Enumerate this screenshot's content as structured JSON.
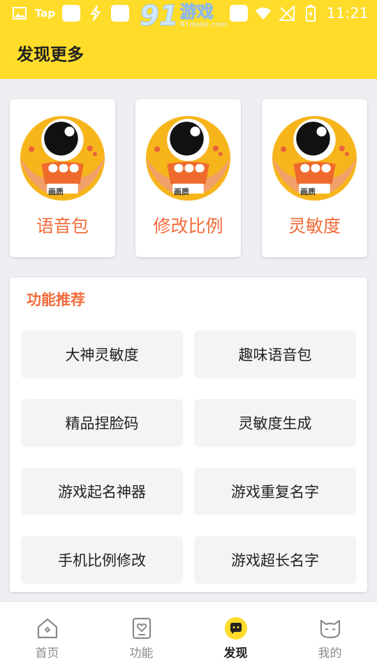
{
  "status_bar": {
    "app_badge": "Tap",
    "time": "11:21"
  },
  "watermark": {
    "number": "91",
    "brand": "游戏",
    "site": "91danji.com"
  },
  "header": {
    "title": "发现更多"
  },
  "feature_cards": [
    {
      "label": "语音包",
      "avatar_badge": "画质"
    },
    {
      "label": "修改比例",
      "avatar_badge": "画质"
    },
    {
      "label": "灵敏度",
      "avatar_badge": "画质"
    }
  ],
  "recommend": {
    "title": "功能推荐",
    "items": [
      "大神灵敏度",
      "趣味语音包",
      "精品捏脸码",
      "灵敏度生成",
      "游戏起名神器",
      "游戏重复名字",
      "手机比例修改",
      "游戏超长名字"
    ]
  },
  "tabs": [
    {
      "label": "首页",
      "icon": "home-icon",
      "active": false
    },
    {
      "label": "功能",
      "icon": "heart-card-icon",
      "active": false
    },
    {
      "label": "发现",
      "icon": "discover-chat-icon",
      "active": true
    },
    {
      "label": "我的",
      "icon": "cat-face-icon",
      "active": false
    }
  ],
  "colors": {
    "brand_yellow": "#ffdc2a",
    "accent_orange": "#f26b3a",
    "background": "#efeff3"
  }
}
